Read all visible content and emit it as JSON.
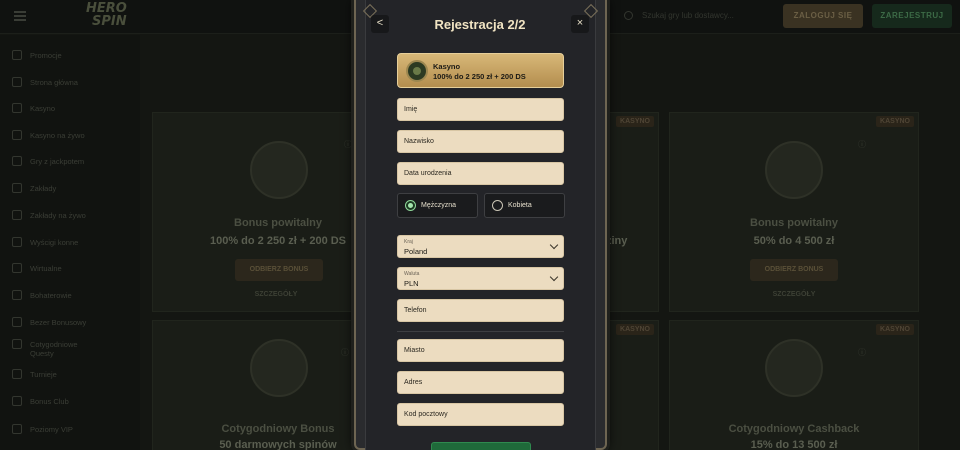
{
  "header": {
    "logo_line1": "HERO",
    "logo_line2": "SPIN",
    "search_placeholder": "Szukaj gry lub dostawcy...",
    "login_label": "ZALOGUJ SIĘ",
    "register_label": "ZAREJESTRUJ"
  },
  "sidebar": {
    "items": [
      {
        "label": "Promocje",
        "icon": "gift-icon"
      },
      {
        "label": "Strona główna",
        "icon": "home-icon"
      },
      {
        "label": "Kasyno",
        "icon": "casino-icon"
      },
      {
        "label": "Kasyno na żywo",
        "icon": "live-casino-icon"
      },
      {
        "label": "Gry z jackpotem",
        "icon": "jackpot-icon"
      },
      {
        "label": "Zakłady",
        "icon": "bets-icon"
      },
      {
        "label": "Zakłady na żywo",
        "icon": "live-bets-icon"
      },
      {
        "label": "Wyścigi konne",
        "icon": "horse-icon"
      },
      {
        "label": "Wirtualne",
        "icon": "virtual-icon"
      },
      {
        "label": "Bohaterowie",
        "icon": "heroes-icon"
      },
      {
        "label": "Bezer Bonusowy",
        "icon": "bonus-icon"
      },
      {
        "label": "Cotygodniowe Questy",
        "icon": "quest-icon"
      },
      {
        "label": "Turnieje",
        "icon": "trophy-icon"
      },
      {
        "label": "Bonus Club",
        "icon": "club-icon"
      },
      {
        "label": "Poziomy VIP",
        "icon": "vip-icon"
      }
    ]
  },
  "cards": {
    "welcome_title": "Bonus powitalny",
    "welcome_value": "100% do 2 250 zł + 200 DS",
    "welcome2_title": "Bonus powitalny",
    "welcome2_value": "50% do 4 500 zł",
    "middle_value": "ziny",
    "weekly_title": "Cotygodniowy Bonus",
    "weekly_value": "50 darmowych spinów",
    "cashback_title": "Cotygodniowy Cashback",
    "cashback_value": "15% do 13 500 zł",
    "tag": "KASYNO",
    "cta": "ODBIERZ BONUS",
    "details": "SZCZEGÓŁY"
  },
  "modal": {
    "title": "Rejestracja 2/2",
    "back": "<",
    "close": "×",
    "bonus": {
      "category": "Kasyno",
      "offer": "100% do 2 250 zł + 200 DS"
    },
    "fields": {
      "first_name": "Imię",
      "last_name": "Nazwisko",
      "birth_date": "Data urodzenia",
      "country_label": "Kraj",
      "country_value": "Poland",
      "currency_label": "Waluta",
      "currency_value": "PLN",
      "phone": "Telefon",
      "city": "Miasto",
      "address": "Adres",
      "postal_code": "Kod pocztowy"
    },
    "gender": {
      "male": "Mężczyzna",
      "female": "Kobieta",
      "selected": "male"
    }
  }
}
